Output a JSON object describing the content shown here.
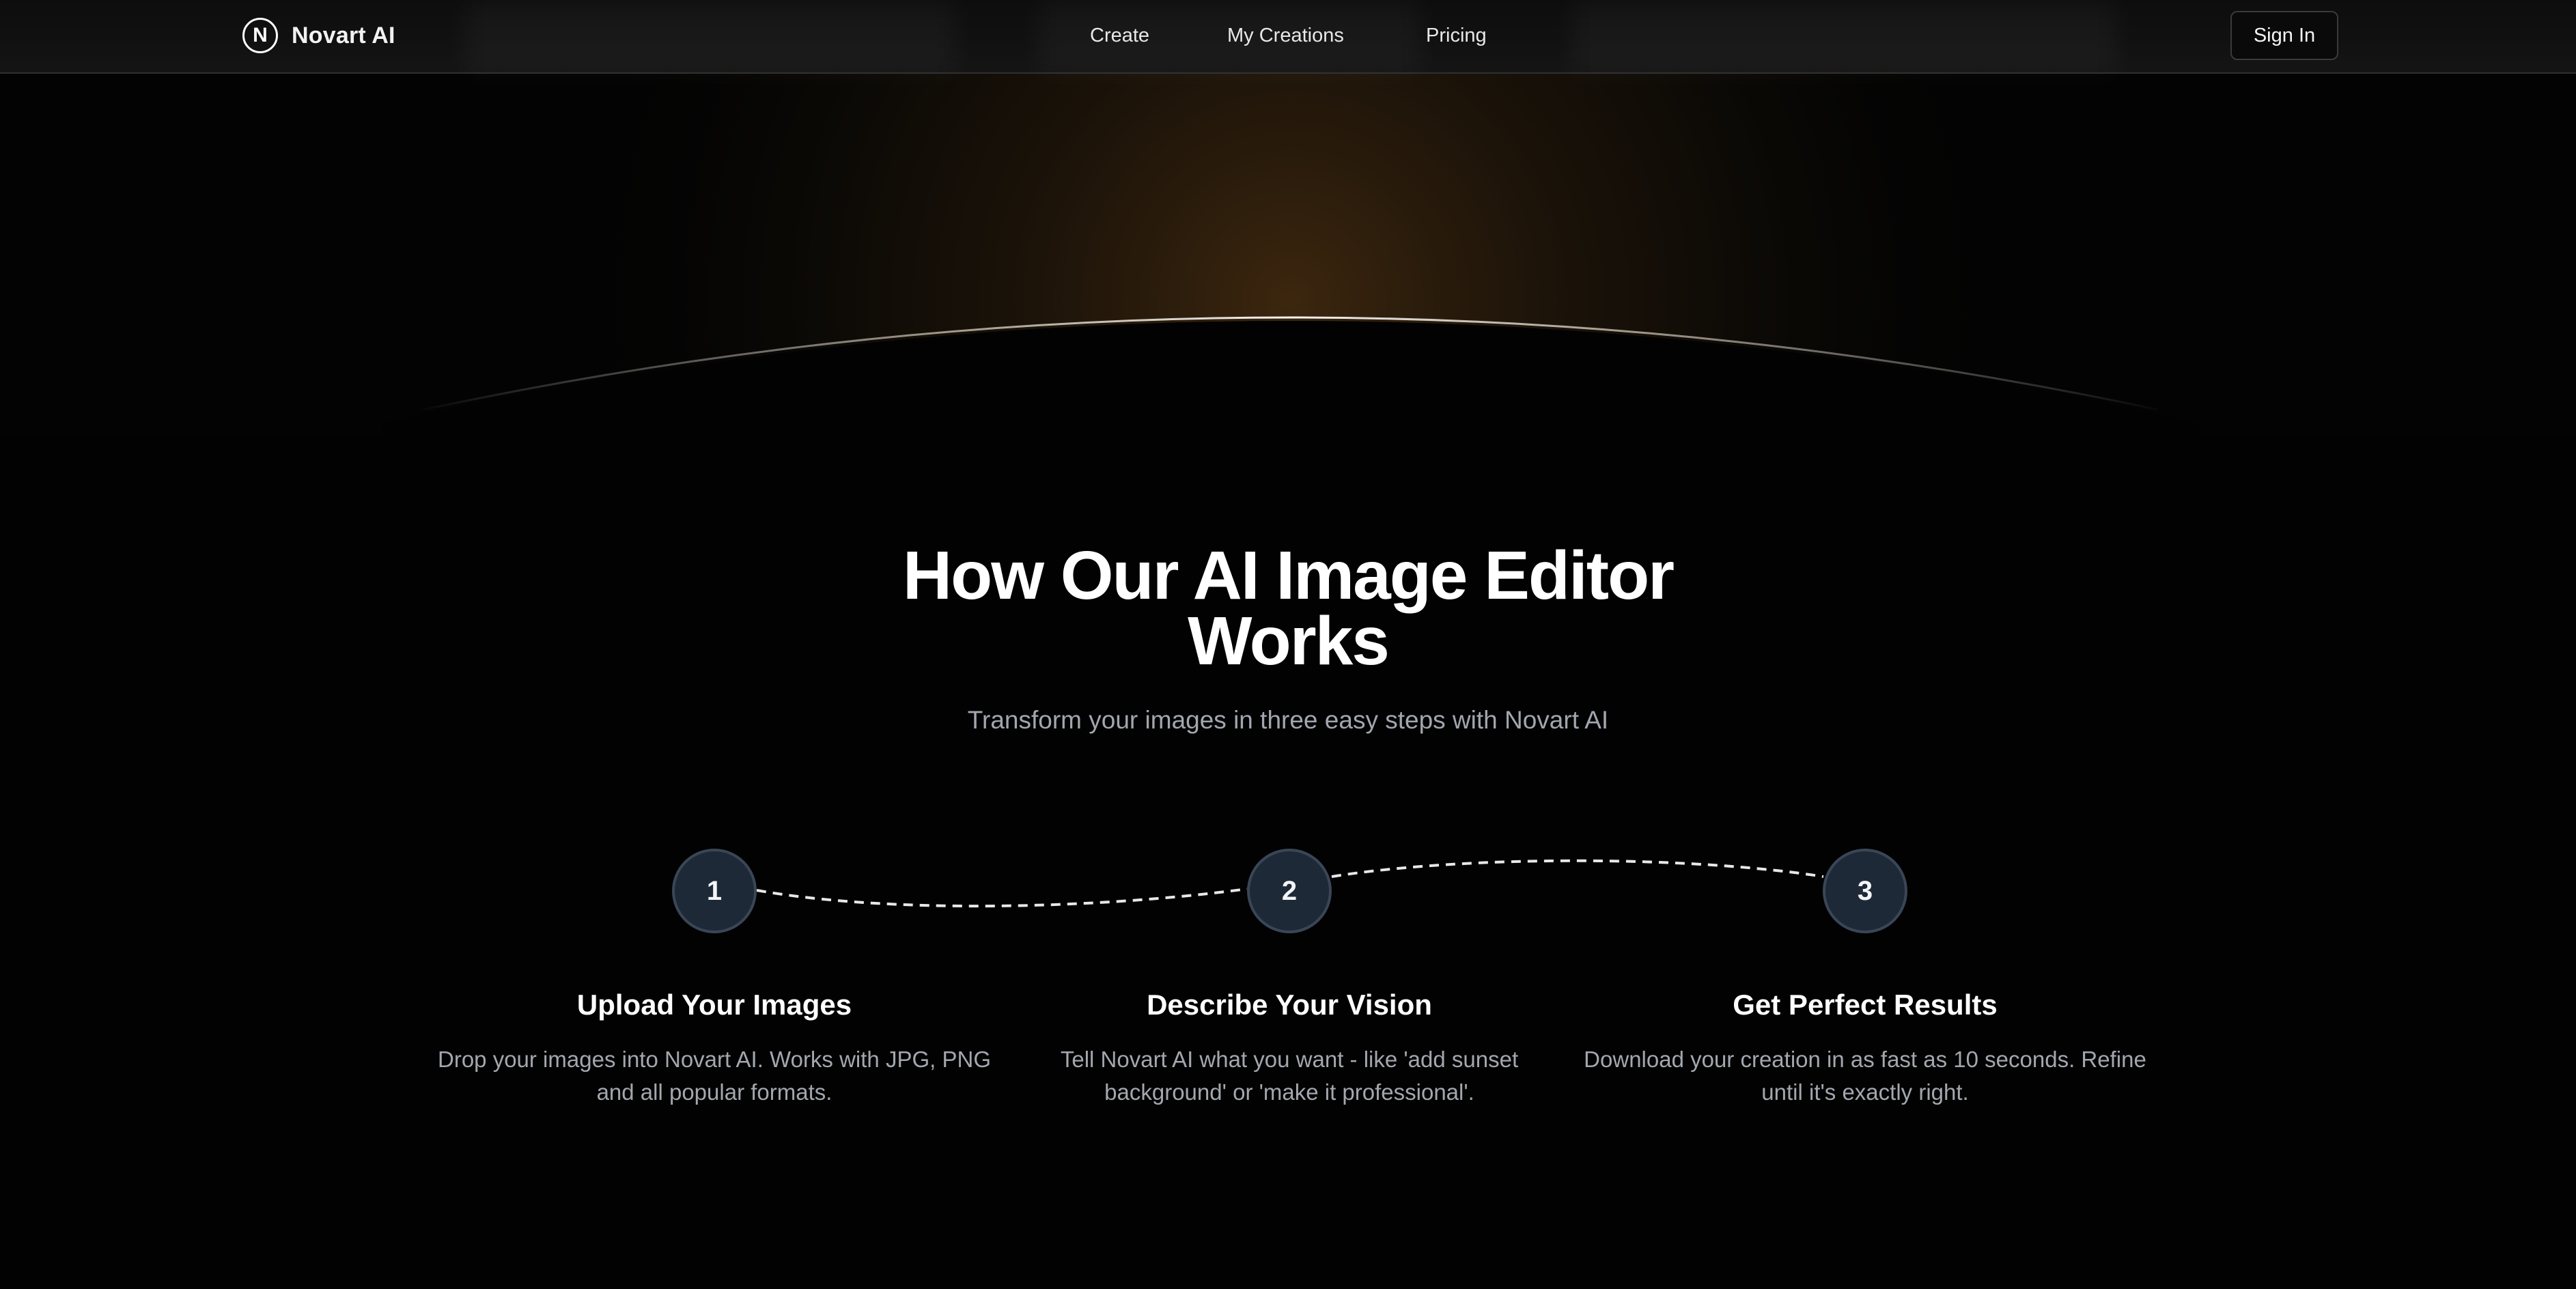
{
  "brand": {
    "logo_letter": "N",
    "name": "Novart AI"
  },
  "nav": {
    "links": [
      "Create",
      "My Creations",
      "Pricing"
    ],
    "signin_label": "Sign In"
  },
  "hero": {
    "title": "How Our AI Image Editor Works",
    "subtitle": "Transform your images in three easy steps with Novart AI"
  },
  "steps": [
    {
      "number": "1",
      "title": "Upload Your Images",
      "description": "Drop your images into Novart AI. Works with JPG, PNG and all popular formats."
    },
    {
      "number": "2",
      "title": "Describe Your Vision",
      "description": "Tell Novart AI what you want - like 'add sunset background' or 'make it professional'."
    },
    {
      "number": "3",
      "title": "Get Perfect Results",
      "description": "Download your creation in as fast as 10 seconds. Refine until it's exactly right."
    }
  ],
  "colors": {
    "background": "#020202",
    "accent_glow": "#7a4a1c",
    "step_circle": "#1e2938",
    "muted_text": "#a2a6ae"
  },
  "icons": {
    "logo": "letter-n-circle-icon"
  }
}
